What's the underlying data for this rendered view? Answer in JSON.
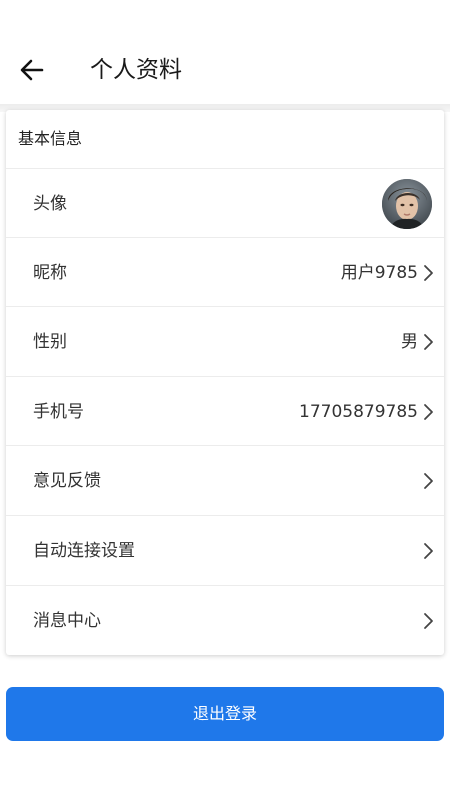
{
  "header": {
    "title": "个人资料",
    "back_icon": "arrow-left-icon"
  },
  "card": {
    "section_title": "基本信息",
    "rows": [
      {
        "label": "头像",
        "value": "",
        "icon": "avatar-photo"
      },
      {
        "label": "昵称",
        "value": "用户9785",
        "icon": "chevron-right-icon"
      },
      {
        "label": "性别",
        "value": "男",
        "icon": "chevron-right-icon"
      },
      {
        "label": "手机号",
        "value": "17705879785",
        "icon": "chevron-right-icon"
      },
      {
        "label": "意见反馈",
        "value": "",
        "icon": "chevron-right-icon"
      },
      {
        "label": "自动连接设置",
        "value": "",
        "icon": "chevron-right-icon"
      },
      {
        "label": "消息中心",
        "value": "",
        "icon": "chevron-right-icon"
      }
    ]
  },
  "logout": {
    "label": "退出登录"
  },
  "colors": {
    "primary_button": "#1f78ea",
    "text": "#333333",
    "divider": "#ececec"
  }
}
